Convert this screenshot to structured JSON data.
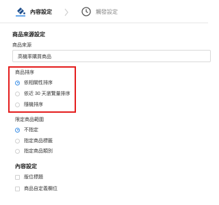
{
  "tabs": {
    "content": {
      "label": "內容設定",
      "icon": "paint-bucket-icon"
    },
    "trigger": {
      "label": "觸發設定",
      "icon": "clock-icon"
    }
  },
  "product_source_settings": {
    "title": "商品來源設定",
    "source_label": "商品來源",
    "source_value": "高機率購買商品"
  },
  "product_sort": {
    "label": "商品排序",
    "options": [
      {
        "label": "依相關性排序",
        "checked": true
      },
      {
        "label": "依近 30 天瀏覽量排序",
        "checked": false
      },
      {
        "label": "隨機排序",
        "checked": false
      }
    ]
  },
  "product_scope": {
    "label": "限定商品範圍",
    "options": [
      {
        "label": "不指定",
        "checked": true
      },
      {
        "label": "指定商品標籤",
        "checked": false
      },
      {
        "label": "指定商品類別",
        "checked": false
      }
    ]
  },
  "content_settings": {
    "title": "內容設定",
    "options": [
      {
        "label": "版位標題",
        "checked": false
      },
      {
        "label": "商品自定義欄位",
        "checked": false
      }
    ]
  },
  "colors": {
    "accent": "#3a8ee6",
    "highlight": "#e41b1b"
  }
}
